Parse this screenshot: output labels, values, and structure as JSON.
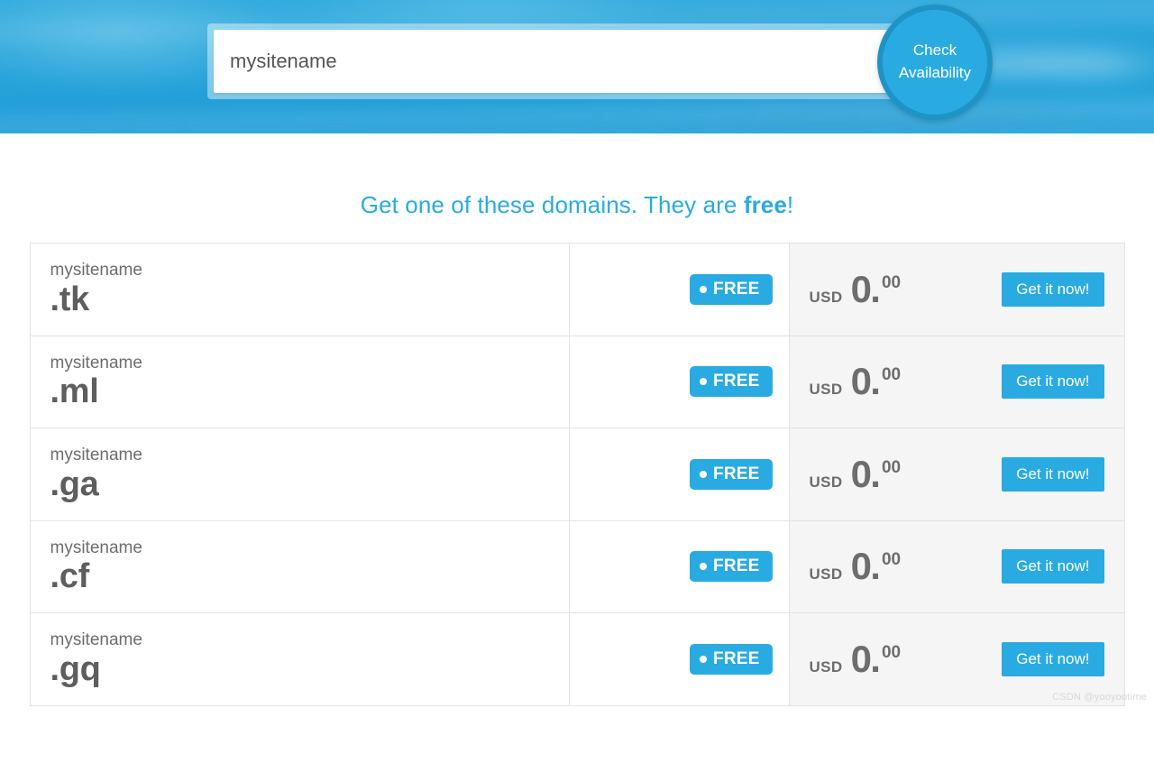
{
  "header": {
    "search": {
      "value": "mysitename",
      "placeholder": "Enter your preferred domain name"
    },
    "check_button_label": "Check\nAvailability",
    "check_button_line1": "Check",
    "check_button_line2": "Availability",
    "banner_color": "#29abe2"
  },
  "main": {
    "title_prefix": "Get one of these domains. They are ",
    "title_emphasis": "free",
    "title_suffix": "!",
    "accent_color": "#29abe2",
    "price_cell_bg": "#f5f5f5",
    "rows": [
      {
        "sld": "mysitename",
        "tld": ".tk",
        "badge": "FREE",
        "currency": "USD",
        "price_int": "0",
        "price_dec": "00",
        "action": "Get it now!"
      },
      {
        "sld": "mysitename",
        "tld": ".ml",
        "badge": "FREE",
        "currency": "USD",
        "price_int": "0",
        "price_dec": "00",
        "action": "Get it now!"
      },
      {
        "sld": "mysitename",
        "tld": ".ga",
        "badge": "FREE",
        "currency": "USD",
        "price_int": "0",
        "price_dec": "00",
        "action": "Get it now!"
      },
      {
        "sld": "mysitename",
        "tld": ".cf",
        "badge": "FREE",
        "currency": "USD",
        "price_int": "0",
        "price_dec": "00",
        "action": "Get it now!"
      },
      {
        "sld": "mysitename",
        "tld": ".gq",
        "badge": "FREE",
        "currency": "USD",
        "price_int": "0",
        "price_dec": "00",
        "action": "Get it now!"
      }
    ]
  },
  "watermark": "CSDN @yooyootime"
}
